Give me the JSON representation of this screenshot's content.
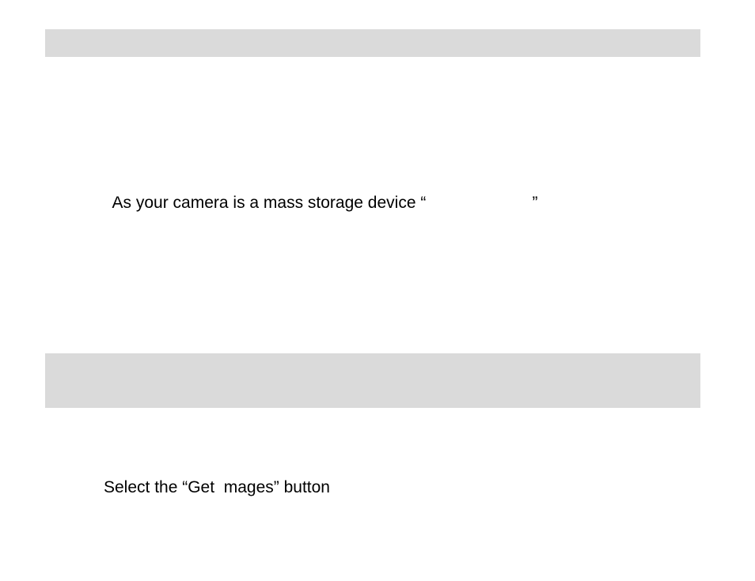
{
  "section1": {
    "line1_part1": "As your camera is a mass storage device “",
    "line1_part2": "”"
  },
  "section2": {
    "line1": "Select the “Get  mages” button"
  }
}
